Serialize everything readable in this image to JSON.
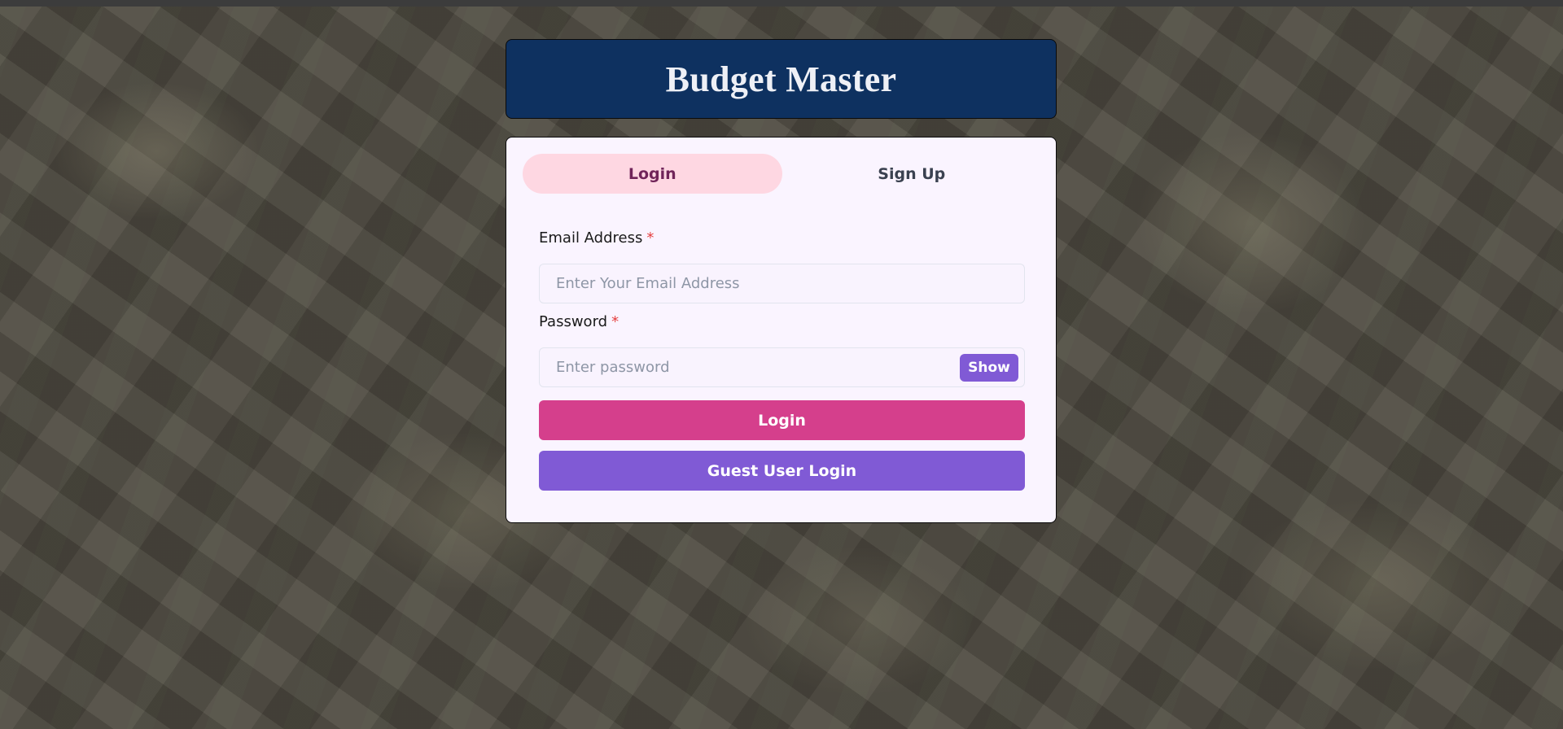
{
  "app": {
    "title": "Budget Master"
  },
  "tabs": [
    {
      "label": "Login",
      "active": true
    },
    {
      "label": "Sign Up",
      "active": false
    }
  ],
  "form": {
    "email": {
      "label": "Email Address",
      "required_mark": "*",
      "placeholder": "Enter Your Email Address",
      "value": ""
    },
    "password": {
      "label": "Password",
      "required_mark": "*",
      "placeholder": "Enter password",
      "value": "",
      "show_label": "Show"
    },
    "login_button": "Login",
    "guest_button": "Guest User Login"
  },
  "colors": {
    "header_bg": "#0e3160",
    "card_bg": "#faf4ff",
    "active_tab_bg": "#fed7e2",
    "active_tab_text": "#702459",
    "login_button": "#d53f8c",
    "guest_button": "#805ad5",
    "show_button": "#805ad5",
    "required": "#e53e3e"
  },
  "background": {
    "description_icon": "money-background"
  }
}
